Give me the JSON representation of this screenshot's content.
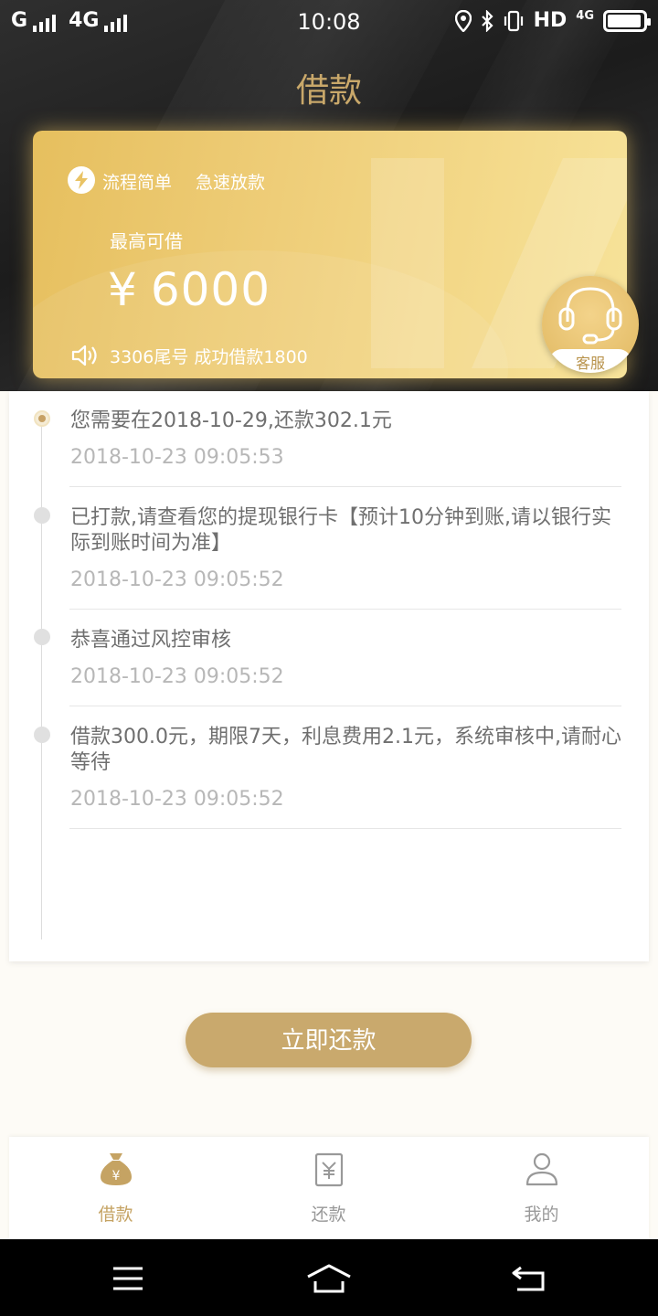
{
  "status_bar": {
    "carrier1": "G",
    "carrier2": "4G",
    "time": "10:08",
    "hd": "HD",
    "net": "4G"
  },
  "header": {
    "title": "借款"
  },
  "card": {
    "tags": [
      "流程简单",
      "急速放款"
    ],
    "label": "最高可借",
    "currency": "¥",
    "amount": "6000",
    "notice": "3306尾号 成功借款1800",
    "service_label": "客服",
    "colors": {
      "gold_start": "#e6bf5e",
      "gold_end": "#f7e39a"
    }
  },
  "timeline": [
    {
      "text": "您需要在2018-10-29,还款302.1元",
      "time": "2018-10-23 09:05:53",
      "active": true
    },
    {
      "text": "已打款,请查看您的提现银行卡【预计10分钟到账,请以银行实际到账时间为准】",
      "time": "2018-10-23 09:05:52",
      "active": false
    },
    {
      "text": "恭喜通过风控审核",
      "time": "2018-10-23 09:05:52",
      "active": false
    },
    {
      "text": "借款300.0元，期限7天，利息费用2.1元，系统审核中,请耐心等待",
      "time": "2018-10-23 09:05:52",
      "active": false
    }
  ],
  "repay_button": "立即还款",
  "bottom_nav": {
    "items": [
      {
        "label": "借款",
        "icon": "money-bag-icon",
        "active": true
      },
      {
        "label": "还款",
        "icon": "receipt-icon",
        "active": false
      },
      {
        "label": "我的",
        "icon": "user-icon",
        "active": false
      }
    ],
    "colors": {
      "active": "#c5a363",
      "inactive": "#999999"
    }
  },
  "system_nav": {
    "icons": [
      "menu-icon",
      "home-icon",
      "back-icon"
    ]
  }
}
